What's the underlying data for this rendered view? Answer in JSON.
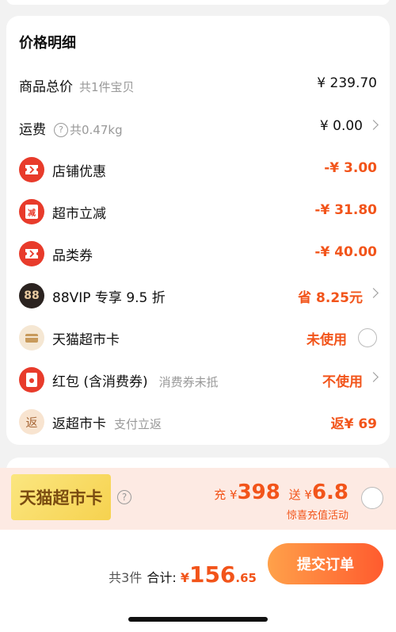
{
  "price_detail": {
    "title": "价格明细",
    "total_goods": {
      "label": "商品总价",
      "sub": "共1件宝贝",
      "value": "¥ 239.70"
    },
    "shipping": {
      "label": "运费",
      "sub": "共0.47kg",
      "value": "¥ 0.00"
    },
    "store_discount": {
      "label": "店铺优惠",
      "value": "-¥ 3.00"
    },
    "supermarket_reduce": {
      "label": "超市立减",
      "value": "-¥ 31.80",
      "icon_text": "减"
    },
    "category_coupon": {
      "label": "品类券",
      "value": "-¥ 40.00"
    },
    "vip": {
      "icon_text": "88",
      "label": "88VIP 专享 9.5 折",
      "value": "省 8.25元"
    },
    "tmall_card": {
      "label": "天猫超市卡",
      "value": "未使用"
    },
    "red_packet": {
      "label": "红包 (含消费券)",
      "sub": "消费券未抵",
      "value": "不使用"
    },
    "return_card": {
      "icon_text": "返",
      "label": "返超市卡",
      "sub": "支付立返",
      "value": "返¥ 69"
    }
  },
  "promo": {
    "badge": "天猫超市卡",
    "recharge_prefix": "充 ¥",
    "recharge_amount": "398",
    "gift_prefix": "送 ¥",
    "gift_amount": "6.8",
    "subtitle": "惊喜充值活动"
  },
  "footer": {
    "count": "共3件",
    "total_label": "合计:",
    "currency": "¥",
    "total_int": "156",
    "total_dec": ".65",
    "submit": "提交订单"
  },
  "colors": {
    "accent": "#f2541a",
    "icon_red": "#e83b2b",
    "promo_bg": "#fdeae3"
  }
}
